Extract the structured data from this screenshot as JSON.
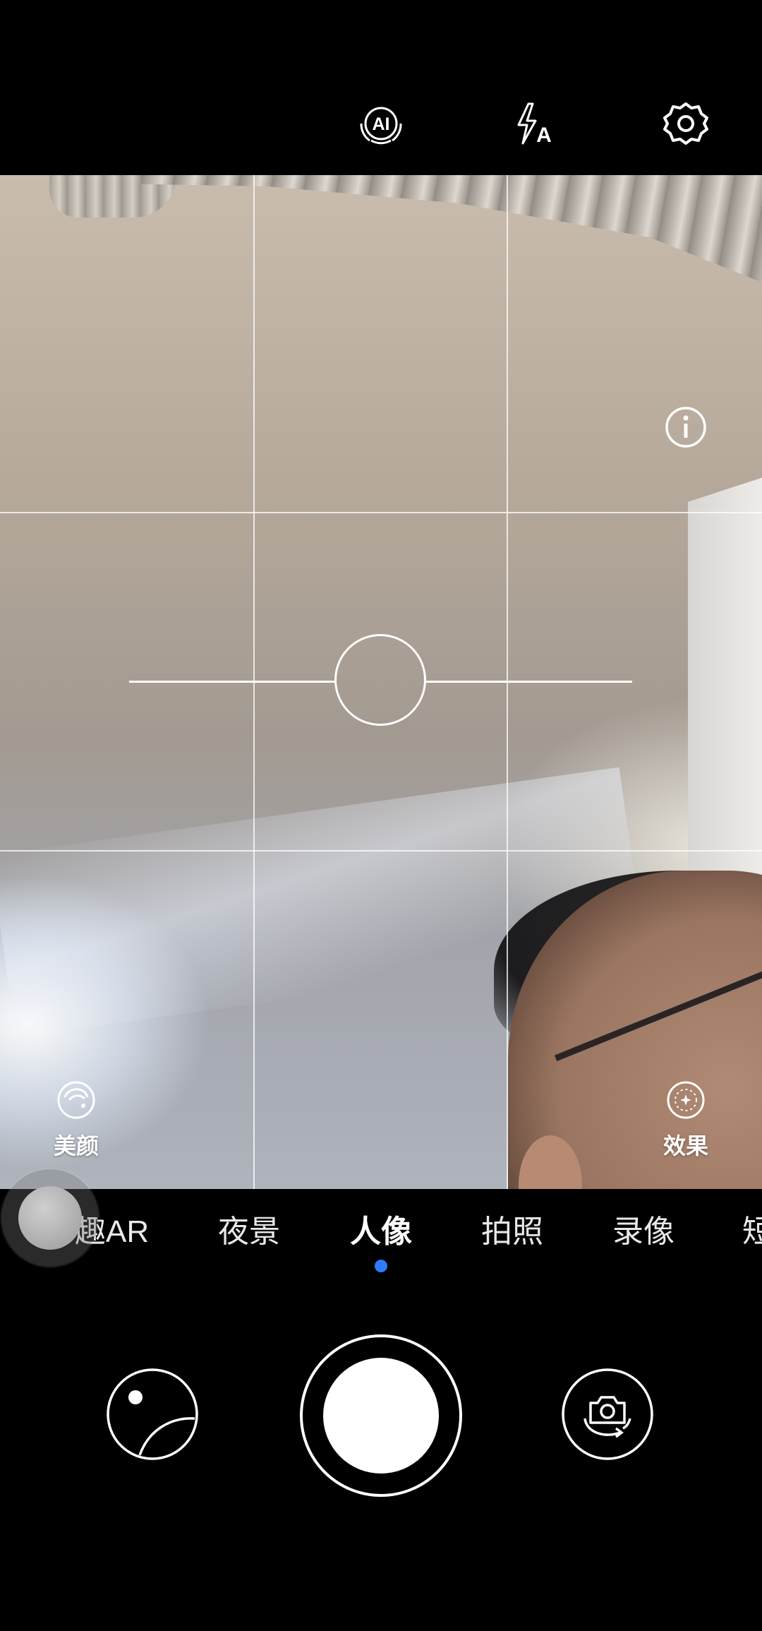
{
  "top_bar": {
    "ai_icon_text": "AI",
    "flash_mode_text": "A",
    "icons": [
      "ai-icon",
      "flash-auto-icon",
      "settings-icon"
    ]
  },
  "viewfinder": {
    "beauty_label": "美颜",
    "effects_label": "效果",
    "icons": [
      "info-icon",
      "beauty-icon",
      "effects-icon"
    ]
  },
  "modes": {
    "items": [
      "趣AR",
      "夜景",
      "人像",
      "拍照",
      "录像",
      "短"
    ],
    "selected": "人像",
    "indicator_color": "#2f7bff"
  },
  "bottom": {
    "icons": [
      "gallery-icon",
      "shutter-button",
      "switch-camera-icon"
    ]
  }
}
